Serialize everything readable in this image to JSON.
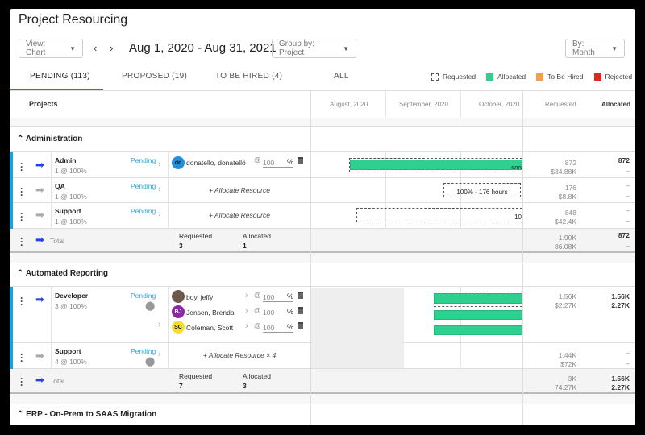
{
  "title": "Project Resourcing",
  "controls": {
    "view": "View: Chart",
    "prev": "‹",
    "next": "›",
    "date_range": "Aug 1, 2020 - Aug 31, 2021",
    "group_by": "Group by: Project",
    "period": "By: Month"
  },
  "tabs": [
    {
      "label": "PENDING (113)"
    },
    {
      "label": "PROPOSED (19)"
    },
    {
      "label": "TO BE HIRED (4)"
    },
    {
      "label": "ALL"
    }
  ],
  "legend": [
    {
      "label": "Requested",
      "color": "dashed"
    },
    {
      "label": "Allocated",
      "color": "#2ecf8f"
    },
    {
      "label": "To Be Hired",
      "color": "#f0a050"
    },
    {
      "label": "Rejected",
      "color": "#d92b1a"
    }
  ],
  "columns": {
    "projects": "Projects",
    "months": [
      "August, 2020",
      "September, 2020",
      "October, 2020"
    ],
    "requested": "Requested",
    "allocated": "Allocated"
  },
  "groups": [
    {
      "name": "Administration",
      "roles": [
        {
          "name": "Admin",
          "sub": "1 @ 100%",
          "status": "Pending",
          "resources": [
            {
              "initials": "dd",
              "name": "donatello, donatello",
              "pct": "100"
            }
          ],
          "req": [
            "872",
            "$34.88K"
          ],
          "alloc": [
            "872",
            "–"
          ],
          "bar_text": "100"
        },
        {
          "name": "QA",
          "sub": "1 @ 100%",
          "status": "Pending",
          "allocate": "+ Allocate Resource",
          "req": [
            "176",
            "$8.8K"
          ],
          "alloc": [
            "–",
            "–"
          ],
          "bar_text": "100% - 176 hours"
        },
        {
          "name": "Support",
          "sub": "1 @ 100%",
          "status": "Pending",
          "allocate": "+ Allocate Resource",
          "req": [
            "848",
            "$42.4K"
          ],
          "alloc": [
            "–",
            "–"
          ],
          "bar_text": "10"
        }
      ],
      "total": {
        "label": "Total",
        "requested_label": "Requested",
        "requested": "3",
        "allocated_label": "Allocated",
        "allocated": "1",
        "req": [
          "1.90K",
          "86.08K"
        ],
        "alloc": [
          "872",
          "–"
        ]
      }
    },
    {
      "name": "Automated Reporting",
      "roles": [
        {
          "name": "Developer",
          "sub": "3 @ 100%",
          "status": "Pending",
          "resources": [
            {
              "initials": "",
              "name": "boy, jeffy",
              "pct": "100"
            },
            {
              "initials": "BJ",
              "name": "Jensen, Brenda",
              "pct": "100"
            },
            {
              "initials": "SC",
              "name": "Coleman, Scott",
              "pct": "100"
            }
          ],
          "req": [
            "1.56K",
            "$2.27K"
          ],
          "alloc": [
            "1.56K",
            "2.27K"
          ]
        },
        {
          "name": "Support",
          "sub": "4 @ 100%",
          "status": "Pending",
          "allocate": "+ Allocate Resource × 4",
          "req": [
            "1.44K",
            "$72K"
          ],
          "alloc": [
            "–",
            "–"
          ]
        }
      ],
      "total": {
        "label": "Total",
        "requested_label": "Requested",
        "requested": "7",
        "allocated_label": "Allocated",
        "allocated": "3",
        "req": [
          "3K",
          "74.27K"
        ],
        "alloc": [
          "1.56K",
          "2.27K"
        ]
      }
    },
    {
      "name": "ERP - On-Prem to SAAS Migration"
    }
  ]
}
